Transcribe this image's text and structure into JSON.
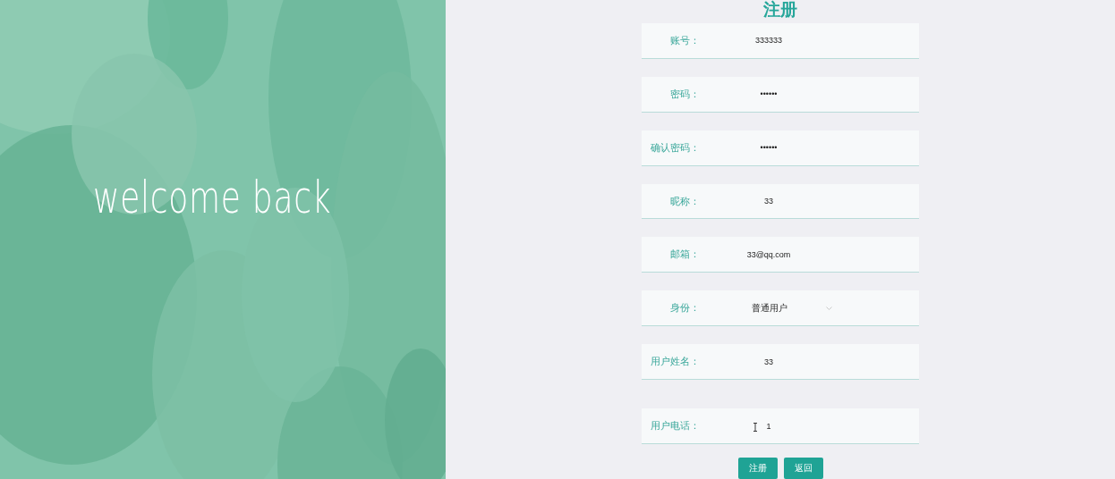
{
  "hero": {
    "kind": "picture",
    "heading": "welcome back"
  },
  "form": {
    "title": "注册",
    "fields": [
      {
        "label": "账号：",
        "kind": "text",
        "value": "333333"
      },
      {
        "label": "密码：",
        "kind": "text",
        "value": "••••••"
      },
      {
        "label": "确认密码：",
        "kind": "text",
        "value": "••••••"
      },
      {
        "label": "昵称：",
        "kind": "text",
        "value": "33"
      },
      {
        "label": "邮箱：",
        "kind": "text",
        "value": "33@qq.com"
      },
      {
        "label": "身份：",
        "kind": "select",
        "value": "普通用户"
      },
      {
        "label": "用户姓名：",
        "kind": "text",
        "value": "33"
      },
      {
        "label": "用户电话：",
        "kind": "text",
        "value": "1",
        "hovered": true
      }
    ],
    "buttons": [
      "注册",
      "返回"
    ]
  }
}
